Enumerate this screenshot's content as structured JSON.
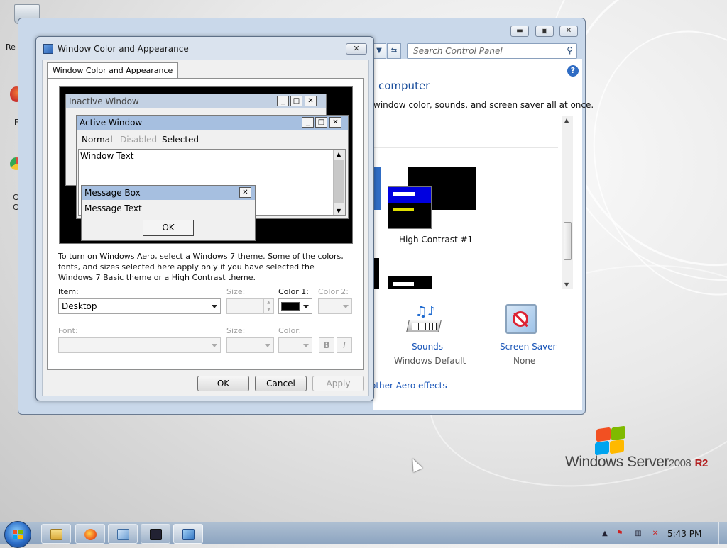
{
  "dialog": {
    "title": "Window Color and Appearance",
    "close_glyph": "✕",
    "tab_label": "Window Color and Appearance",
    "preview": {
      "inactive_title": "Inactive Window",
      "active_title": "Active Window",
      "menu_normal": "Normal",
      "menu_disabled": "Disabled",
      "menu_selected": "Selected",
      "window_text": "Window Text",
      "message_box_title": "Message Box",
      "message_text": "Message Text",
      "ok_label": "OK"
    },
    "info_text": "To turn on Windows Aero, select a Windows 7 theme.  Some of the colors, fonts, and sizes selected here apply only if you have selected the Windows 7 Basic theme or a High Contrast theme.",
    "item_label": "Item:",
    "item_value": "Desktop",
    "size_label": "Size:",
    "color1_label": "Color 1:",
    "color1_value": "#000000",
    "color2_label": "Color 2:",
    "font_label": "Font:",
    "font_size_label": "Size:",
    "font_color_label": "Color:",
    "bold_label": "B",
    "italic_label": "I",
    "ok_button": "OK",
    "cancel_button": "Cancel",
    "apply_button": "Apply"
  },
  "control_panel": {
    "search_placeholder": "Search Control Panel",
    "heading": "computer",
    "description": "window color, sounds, and screen saver all at once.",
    "theme_label": "High Contrast #1",
    "sounds_label": "Sounds",
    "sounds_value": "Windows Default",
    "screensaver_label": "Screen Saver",
    "screensaver_value": "None",
    "aero_link": "other Aero effects",
    "help_glyph": "?"
  },
  "desktop": {
    "icon1_label": "Re",
    "icon2_label": "F",
    "icon3_label": "C",
    "icon4_label": "C"
  },
  "branding": {
    "product": "Windows Server",
    "year": "2008",
    "release": "R2"
  },
  "taskbar": {
    "clock": "5:43 PM",
    "tray_arrow": "▲"
  },
  "colors": {
    "accent": "#1c4f9c",
    "link": "#1a56b8",
    "titlebar_active": "#a6bfe0",
    "titlebar_inactive": "#c3d1e3"
  }
}
